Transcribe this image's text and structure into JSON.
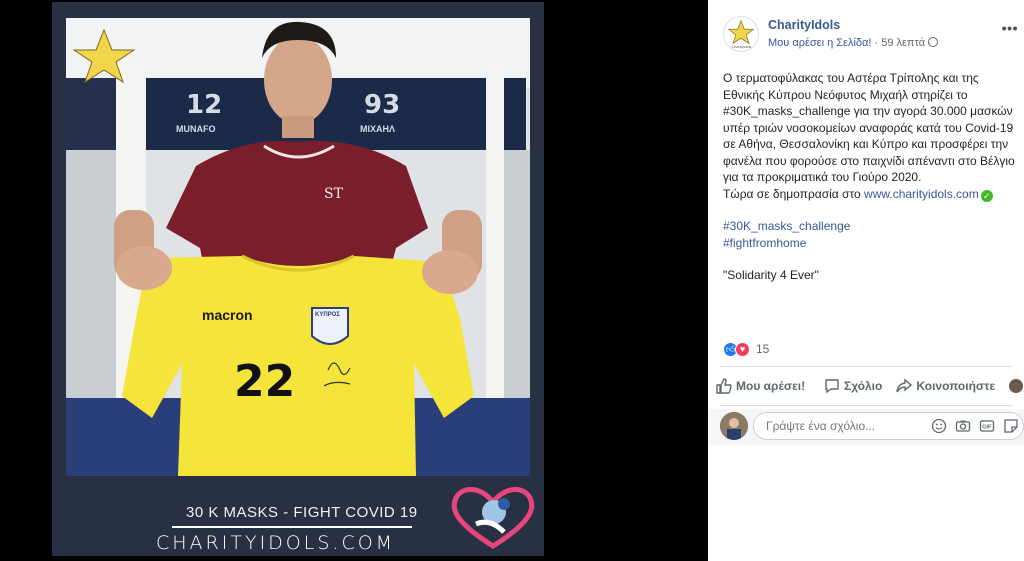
{
  "poster": {
    "caption_line1": "30 K MASKS  - FIGHT COVID 19",
    "caption_line2": "CHARITYIDOLS.COM",
    "logo_text": "CharityIdols",
    "jersey": {
      "number": "22",
      "brand": "macron",
      "crest": "ΚΥΠΡΟΣ"
    },
    "locker_names": [
      {
        "number": "12",
        "name": "MUNAFO"
      },
      {
        "number": "93",
        "name": "ΜΙΧΑΗΛ"
      }
    ]
  },
  "post": {
    "page_name": "CharityIdols",
    "like_page": "Μου αρέσει η Σελίδα!",
    "separator": " · ",
    "time": "59 λεπτά",
    "more_label": "•••",
    "body": "Ο τερματοφύλακας του Αστέρα Τρίπολης και της Εθνικής Κύπρου Νεόφυτος Μιχαήλ στηρίζει το #30K_masks_challenge για την αγορά 30.000 μασκών υπέρ τριών νοσοκομείων αναφοράς κατά του Covid-19 σε Αθήνα, Θεσσαλονίκη και Κύπρο και προσφέρει την φανέλα που φορούσε στο παιχνίδι απέναντι στο Βέλγιο για τα προκριματικά του Γιούρο 2020.",
    "auction_text": "Τώρα σε δημοπρασία στο ",
    "auction_link": "www.charityidols.com",
    "hashtag1": "#30K_masks_challenge",
    "hashtag2": "#fightfromhome",
    "quote": "\"Solidarity 4 Ever\"",
    "reaction_count": "15",
    "actions": {
      "like": "Μου αρέσει!",
      "comment": "Σχόλιο",
      "share": "Κοινοποιήστε"
    },
    "comment_placeholder": "Γράψτε ένα σχόλιο..."
  },
  "colors": {
    "link": "#385898",
    "poster_bg": "#283044",
    "jersey": "#f5e43a",
    "shirt": "#7b1e2b",
    "like_blue": "#2078f4",
    "love_red": "#f33e58",
    "check_green": "#42b72a"
  },
  "icons": [
    "star-logo-icon",
    "globe-icon",
    "more-icon",
    "check-icon",
    "like-reaction-icon",
    "love-reaction-icon",
    "thumbs-up-icon",
    "comment-icon",
    "share-icon",
    "chevron-down-icon",
    "emoji-icon",
    "camera-icon",
    "gif-icon",
    "sticker-icon",
    "heart-logo-icon"
  ]
}
